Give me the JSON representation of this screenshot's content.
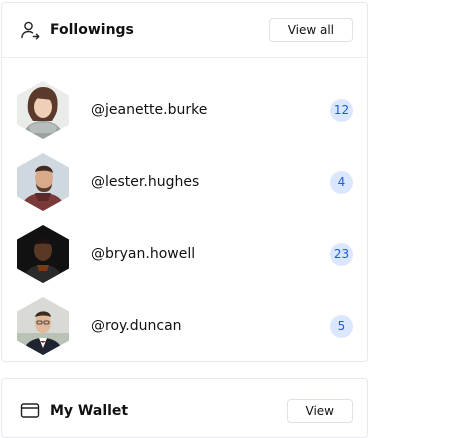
{
  "followings": {
    "title": "Followings",
    "view_all_label": "View all",
    "icon": "user-follow-icon",
    "items": [
      {
        "handle": "@jeanette.burke",
        "count": "12"
      },
      {
        "handle": "@lester.hughes",
        "count": "4"
      },
      {
        "handle": "@bryan.howell",
        "count": "23"
      },
      {
        "handle": "@roy.duncan",
        "count": "5"
      }
    ]
  },
  "wallet": {
    "title": "My Wallet",
    "view_label": "View",
    "icon": "wallet-icon"
  },
  "colors": {
    "badge_bg": "#dbe7ff",
    "badge_text": "#1e5bd6",
    "border": "#e7e9ee"
  }
}
